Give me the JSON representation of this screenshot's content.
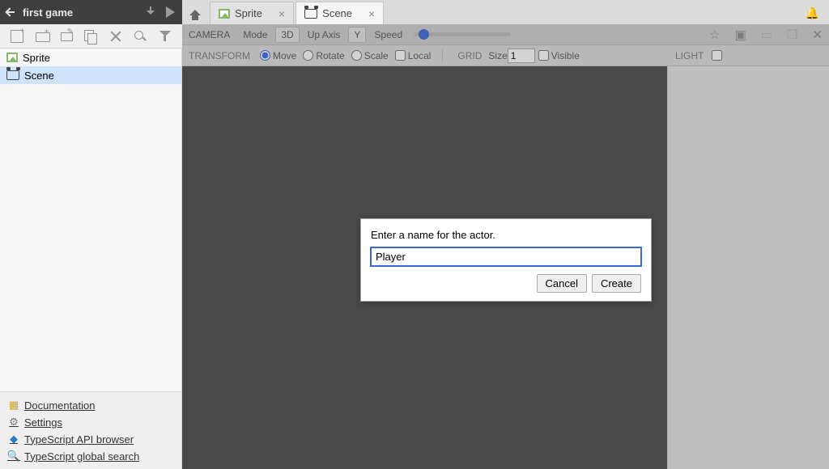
{
  "project": {
    "name": "first game"
  },
  "assets": [
    {
      "kind": "sprite",
      "label": "Sprite"
    },
    {
      "kind": "scene",
      "label": "Scene"
    }
  ],
  "selected_asset_index": 1,
  "tabs": [
    {
      "kind": "sprite",
      "label": "Sprite",
      "active": false
    },
    {
      "kind": "scene",
      "label": "Scene",
      "active": true
    }
  ],
  "camera": {
    "section": "CAMERA",
    "mode_label": "Mode",
    "mode_value": "3D",
    "upaxis_label": "Up Axis",
    "upaxis_value": "Y",
    "speed_label": "Speed"
  },
  "transform": {
    "section": "TRANSFORM",
    "move": "Move",
    "rotate": "Rotate",
    "scale": "Scale",
    "local": "Local",
    "selected": "move"
  },
  "grid": {
    "section": "GRID",
    "size_label": "Size",
    "size_value": "1",
    "visible_label": "Visible"
  },
  "light": {
    "section": "LIGHT"
  },
  "dialog": {
    "prompt": "Enter a name for the actor.",
    "value": "Player",
    "cancel": "Cancel",
    "create": "Create"
  },
  "links": {
    "documentation": "Documentation",
    "settings": "Settings",
    "api": "TypeScript API browser",
    "search": "TypeScript global search"
  }
}
